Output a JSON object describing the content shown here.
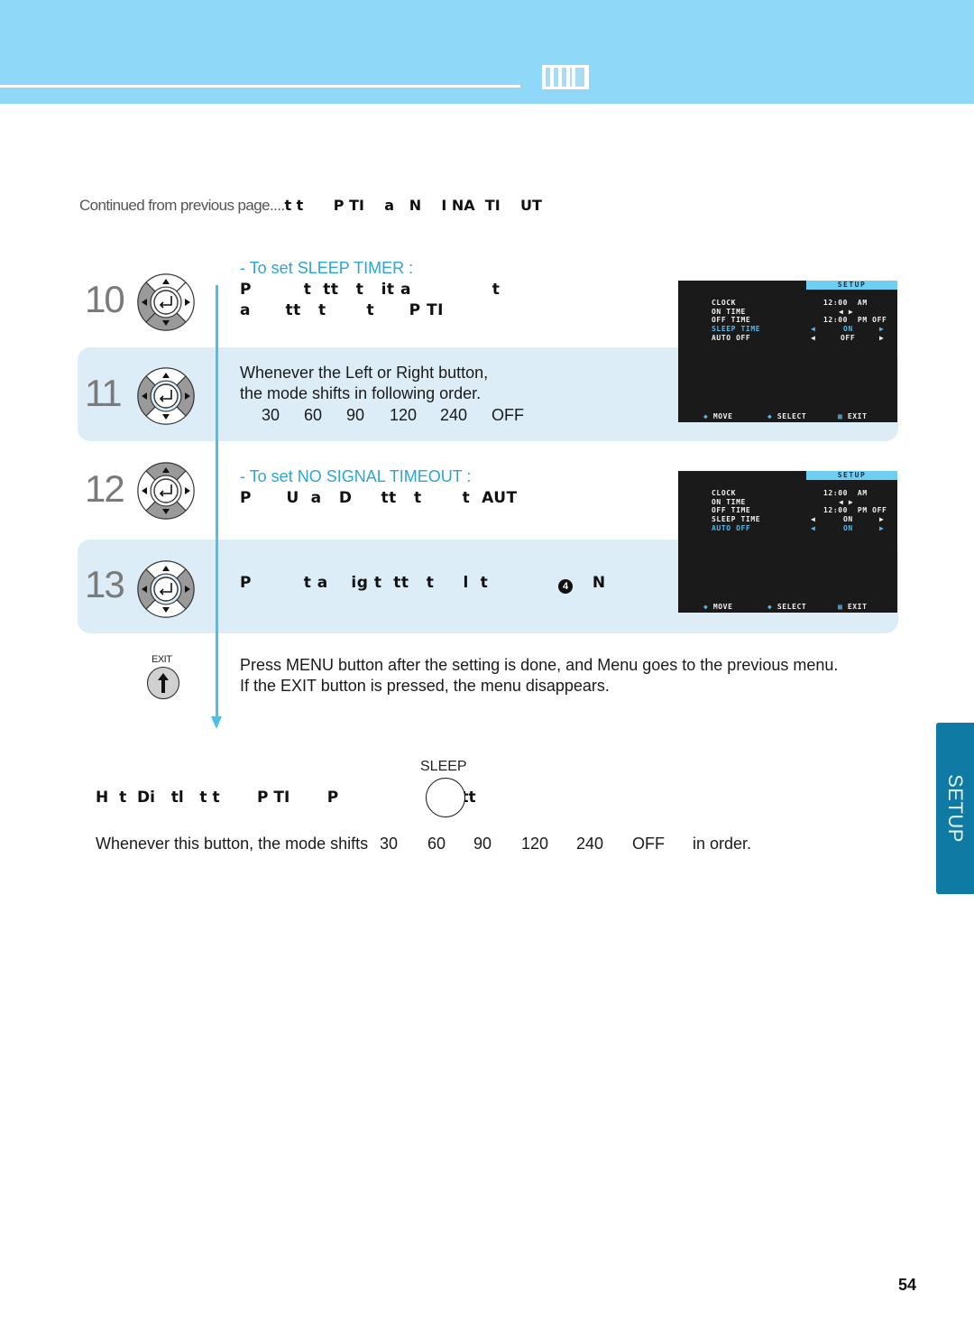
{
  "header": {
    "section_icon": "setup-section-icon"
  },
  "continued": {
    "prefix": "Continued from previous page....",
    "bold": "t t      P TI    a   N    I NA  TI    UT"
  },
  "steps": [
    {
      "number": "10",
      "dpad_highlight": [
        "left",
        "down"
      ],
      "subhead": "- To set SLEEP TIMER :",
      "lines": [
        "P         t  tt   t   it a              t",
        "a      tt   t       t      P TI"
      ]
    },
    {
      "number": "11",
      "dpad_highlight": [
        "left",
        "right"
      ],
      "lines": [
        "Whenever the Left or Right button,",
        "the mode shifts in following order."
      ],
      "sequence": [
        "30",
        "60",
        "90",
        "120",
        "240",
        "OFF"
      ]
    },
    {
      "number": "12",
      "dpad_highlight": [
        "up",
        "down"
      ],
      "subhead": "- To set NO SIGNAL TIMEOUT :",
      "lines": [
        "P      U  a   D     tt   t       t  AUT"
      ]
    },
    {
      "number": "13",
      "dpad_highlight": [
        "left",
        "right"
      ],
      "lines": [
        "P         t a    ig t  tt   t     l  t                  N"
      ],
      "badge": "4"
    }
  ],
  "osd_screens": [
    {
      "title": "SETUP",
      "rows": [
        {
          "label": "CLOCK",
          "value": "12:00  AM",
          "highlight": false
        },
        {
          "label": "ON TIME",
          "value": "◀ ▶",
          "highlight": false
        },
        {
          "label": "OFF TIME",
          "value": "12:00  PM OFF",
          "highlight": false
        },
        {
          "label": "SLEEP TIME",
          "left": "◀",
          "value": "ON",
          "right": "▶",
          "highlight": true
        },
        {
          "label": "AUTO OFF",
          "left": "◀",
          "value": "OFF",
          "right": "▶",
          "highlight": false
        }
      ],
      "footer": {
        "move": "MOVE",
        "select": "SELECT",
        "exit": "EXIT"
      }
    },
    {
      "title": "SETUP",
      "rows": [
        {
          "label": "CLOCK",
          "value": "12:00  AM",
          "highlight": false
        },
        {
          "label": "ON TIME",
          "value": "◀ ▶",
          "highlight": false
        },
        {
          "label": "OFF TIME",
          "value": "12:00  PM OFF",
          "highlight": false
        },
        {
          "label": "SLEEP TIME",
          "left": "◀",
          "value": "ON",
          "right": "▶",
          "highlight": false
        },
        {
          "label": "AUTO OFF",
          "left": "◀",
          "value": "ON",
          "right": "▶",
          "highlight": true
        }
      ],
      "footer": {
        "move": "MOVE",
        "select": "SELECT",
        "exit": "EXIT"
      }
    }
  ],
  "exit_step": {
    "button_label": "EXIT",
    "lines": [
      "Press MENU button after the setting is done, and Menu goes to the previous menu.",
      "If the EXIT button is pressed, the menu disappears."
    ]
  },
  "direct": {
    "bold": "H  t  Di   tl   t t       P TI       P                       tt",
    "sleep_button_label": "SLEEP",
    "sentence_prefix": "Whenever this button, the mode shifts",
    "sequence": [
      "30",
      "60",
      "90",
      "120",
      "240",
      "OFF"
    ],
    "sentence_suffix": "in order."
  },
  "side_tab": {
    "label": "SETUP"
  },
  "page_number": "54",
  "colors": {
    "header_bg": "#8fd8f7",
    "band_bg": "#dcedf8",
    "accent": "#2aa5d6",
    "timeline": "#4fc0e4",
    "side_tab": "#0f7aa3",
    "osd_bg": "#1a1a1a",
    "osd_highlight": "#52b8ea"
  }
}
